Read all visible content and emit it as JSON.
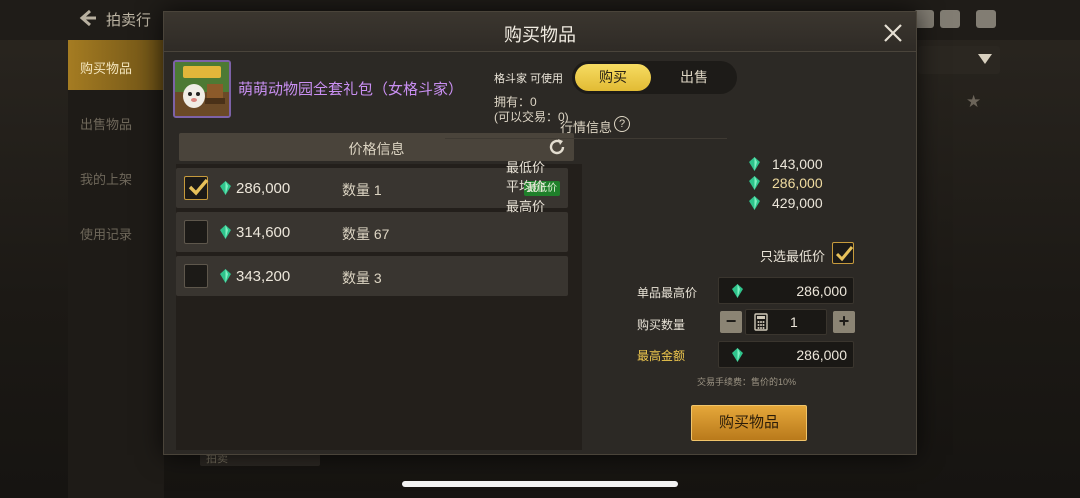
{
  "background": {
    "title": "拍卖行",
    "sidebar": [
      "购买物品",
      "出售物品",
      "我的上架",
      "使用记录"
    ],
    "bottom_field": "拍卖"
  },
  "modal": {
    "title": "购买物品",
    "item": {
      "name": "萌萌动物园全套礼包（女格斗家）",
      "usable": "格斗家 可使用",
      "owned": "拥有：0",
      "tradable": "(可以交易：0)"
    },
    "tabs": {
      "buy": "购买",
      "sell": "出售",
      "active": "buy"
    },
    "price_list": {
      "header": "价格信息",
      "rows": [
        {
          "price": "286,000",
          "qty_label": "数量 1",
          "badge": "最低价",
          "checked": true
        },
        {
          "price": "314,600",
          "qty_label": "数量 67",
          "badge": "",
          "checked": false
        },
        {
          "price": "343,200",
          "qty_label": "数量 3",
          "badge": "",
          "checked": false
        }
      ]
    },
    "market": {
      "title": "行情信息",
      "help": "?",
      "lowest_label": "最低价",
      "lowest_value": "143,000",
      "average_label": "平均价",
      "average_value": "286,000",
      "highest_label": "最高价",
      "highest_value": "429,000"
    },
    "form": {
      "lowest_only_label": "只选最低价",
      "lowest_only_checked": true,
      "unit_max_label": "单品最高价",
      "unit_max_value": "286,000",
      "quantity_label": "购买数量",
      "quantity_value": "1",
      "total_label": "最高金额",
      "total_value": "286,000",
      "fee_note": "交易手续费：售价的10%",
      "minus": "−",
      "plus": "+"
    },
    "buy_button": "购买物品"
  },
  "colors": {
    "accent_gold": "#e2bb34",
    "item_name": "#c98ff2",
    "lowest_badge": "#1f7f2a",
    "gem": "#2fc48c"
  }
}
